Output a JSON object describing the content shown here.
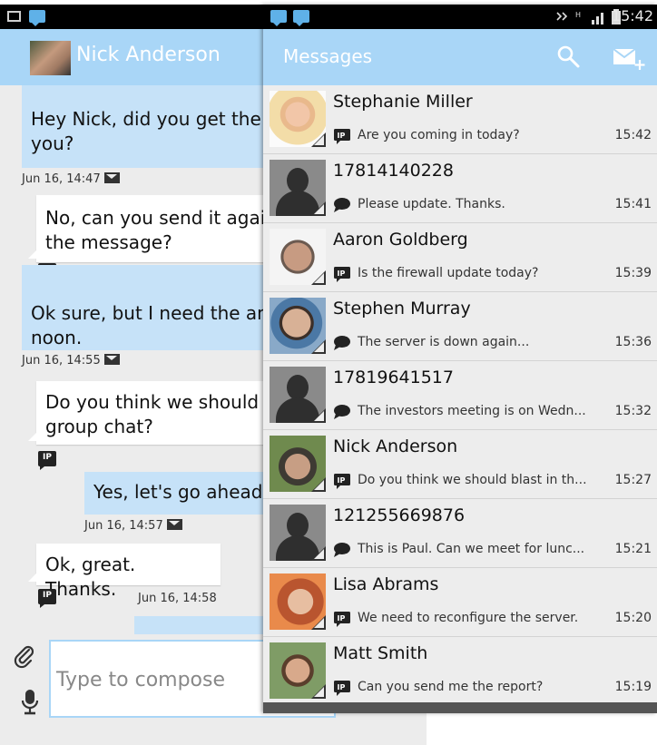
{
  "conversation": {
    "contact_name": "Nick Anderson",
    "messages": [
      {
        "text_1": "Hey Nick, did you get the",
        "text_2": "you?",
        "timestamp": "Jun 16, 14:47"
      },
      {
        "text_1": "No, can you send it agai",
        "text_2": "the message?"
      },
      {
        "text_1": "Ok sure, but I need the an",
        "text_2": "noon.",
        "timestamp": "Jun 16, 14:55"
      },
      {
        "text_1": "Do you think we should",
        "text_2": "group chat?"
      },
      {
        "text_1": "Yes, let's go ahead",
        "timestamp": "Jun 16, 14:57"
      },
      {
        "text_1": "Ok, great. Thanks.",
        "timestamp": "Jun 16, 14:58"
      }
    ],
    "compose_placeholder": "Type to compose"
  },
  "inbox": {
    "title": "Messages",
    "status_time": "15:42",
    "items": [
      {
        "name": "Stephanie Miller",
        "preview": "Are you coming in today?",
        "time": "15:42",
        "type_icon": "ip-message-icon",
        "avatar": "photo"
      },
      {
        "name": "17814140228",
        "preview": "Please update. Thanks.",
        "time": "15:41",
        "type_icon": "sms-bubble-icon",
        "avatar": "default"
      },
      {
        "name": "Aaron Goldberg",
        "preview": "Is the firewall update today?",
        "time": "15:39",
        "type_icon": "ip-message-icon",
        "avatar": "photo"
      },
      {
        "name": "Stephen Murray",
        "preview": "The server is down again...",
        "time": "15:36",
        "type_icon": "sms-bubble-icon",
        "avatar": "photo"
      },
      {
        "name": "17819641517",
        "preview": "The investors meeting is on Wedn...",
        "time": "15:32",
        "type_icon": "sms-bubble-icon",
        "avatar": "default"
      },
      {
        "name": "Nick Anderson",
        "preview": "Do you think we should blast in th...",
        "time": "15:27",
        "type_icon": "ip-message-icon",
        "avatar": "photo"
      },
      {
        "name": "121255669876",
        "preview": "This is Paul. Can we meet for lunc...",
        "time": "15:21",
        "type_icon": "sms-bubble-icon",
        "avatar": "default"
      },
      {
        "name": "Lisa Abrams",
        "preview": "We need to reconfigure the server.",
        "time": "15:20",
        "type_icon": "ip-message-icon",
        "avatar": "photo"
      },
      {
        "name": "Matt Smith",
        "preview": "Can you send me the report?",
        "time": "15:19",
        "type_icon": "ip-message-icon",
        "avatar": "photo"
      }
    ]
  },
  "colors": {
    "header": "#a9d6f7",
    "outgoing_bubble": "#c6e2f8",
    "list_background": "#ededed"
  }
}
